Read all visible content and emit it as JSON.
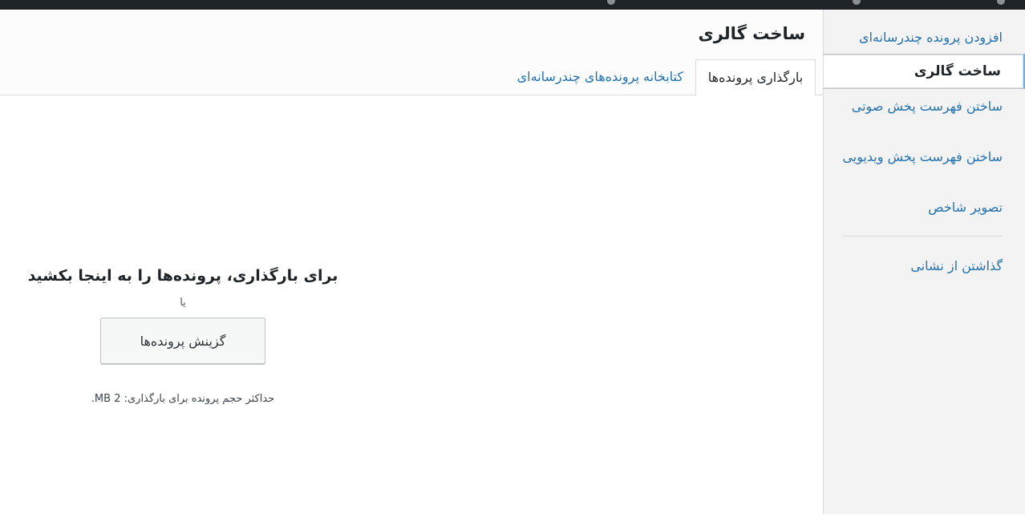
{
  "sidebar": {
    "items": [
      {
        "label": "افزودن پرونده چندرسانه‌ای"
      },
      {
        "label": "ساخت گالری"
      },
      {
        "label": "ساختن فهرست پخش صوتی"
      },
      {
        "label": "ساختن فهرست پخش ویدیویی"
      },
      {
        "label": "تصویر شاخص"
      },
      {
        "label": "گذاشتن از نشانی"
      }
    ]
  },
  "frame": {
    "title": "ساخت گالری",
    "tabs": [
      {
        "label": "بارگذاری پرونده‌ها"
      },
      {
        "label": "کتابخانه پرونده‌های چندرسانه‌ای"
      }
    ]
  },
  "uploader": {
    "drop_title": "برای بارگذاری، پرونده‌ها را به اینجا بکشید",
    "or_text": "یا",
    "select_button": "گزینش پرونده‌ها",
    "max_size": "حداکثر حجم پرونده برای بارگذاری: 2 MB."
  },
  "colors": {
    "link": "#2271b1",
    "admin_bar": "#1d2327",
    "active_border": "#72aee6"
  }
}
